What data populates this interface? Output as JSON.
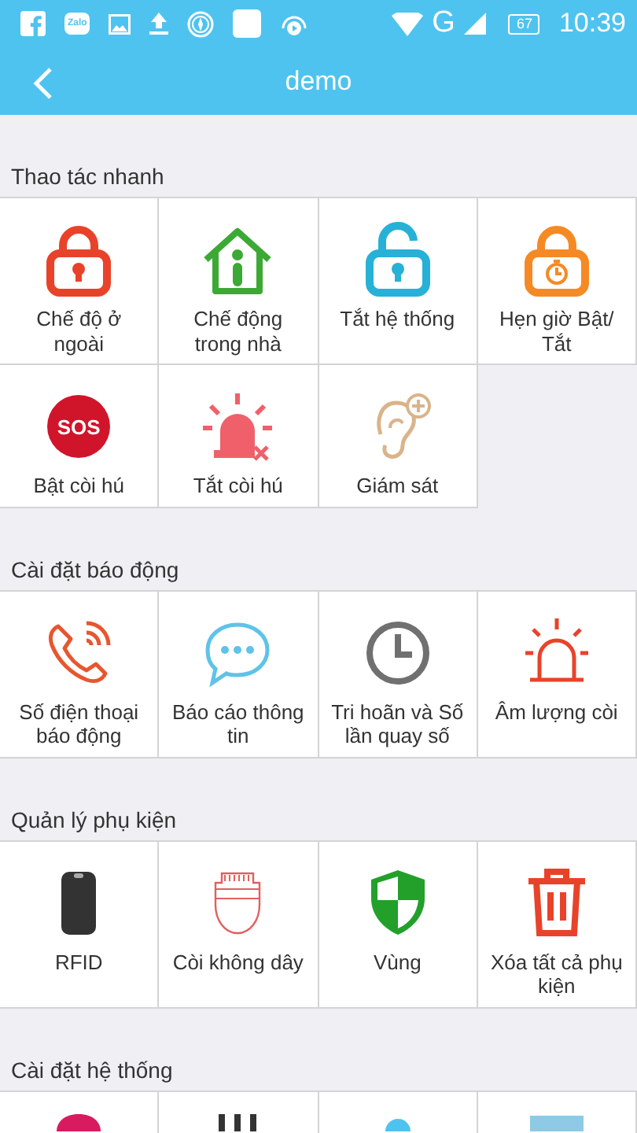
{
  "status_bar": {
    "notifications": [
      {
        "kind": "facebook"
      },
      {
        "kind": "zalo",
        "label": "Zalo"
      },
      {
        "kind": "image"
      },
      {
        "kind": "upload"
      },
      {
        "kind": "compass"
      },
      {
        "kind": "blank"
      },
      {
        "kind": "headphones"
      }
    ],
    "network": "G",
    "battery": "67",
    "time": "10:39"
  },
  "app_bar": {
    "title": "demo"
  },
  "sections": [
    {
      "title": "Thao tác nhanh",
      "items": [
        {
          "kind": "away-lock",
          "label": "Chế độ ở ngoài"
        },
        {
          "kind": "home",
          "label": "Chế động trong nhà"
        },
        {
          "kind": "unlock",
          "label": "Tắt hệ thống"
        },
        {
          "kind": "timer-lock",
          "label": "Hẹn giờ Bật/ Tắt"
        },
        {
          "kind": "sos",
          "label": "Bật còi hú",
          "badge": "SOS"
        },
        {
          "kind": "siren-off",
          "label": "Tắt còi hú"
        },
        {
          "kind": "ear",
          "label": "Giám sát"
        }
      ]
    },
    {
      "title": "Cài đặt báo động",
      "items": [
        {
          "kind": "phone",
          "label": "Số điện thoại báo động"
        },
        {
          "kind": "chat",
          "label": "Báo cáo thông tin"
        },
        {
          "kind": "clock",
          "label": "Tri hoãn và Số lần quay số"
        },
        {
          "kind": "siren",
          "label": "Âm lượng còi"
        }
      ]
    },
    {
      "title": "Quản lý phụ kiện",
      "items": [
        {
          "kind": "rfid",
          "label": "RFID"
        },
        {
          "kind": "wireless-siren",
          "label": "Còi không dây"
        },
        {
          "kind": "shield",
          "label": "Vùng"
        },
        {
          "kind": "trash",
          "label": "Xóa tất cả phụ kiện"
        }
      ]
    },
    {
      "title": "Cài đặt hệ thống",
      "items": [
        {
          "kind": "partial-pink"
        },
        {
          "kind": "partial-dark"
        },
        {
          "kind": "partial-cyan"
        },
        {
          "kind": "partial-blue"
        }
      ]
    }
  ]
}
